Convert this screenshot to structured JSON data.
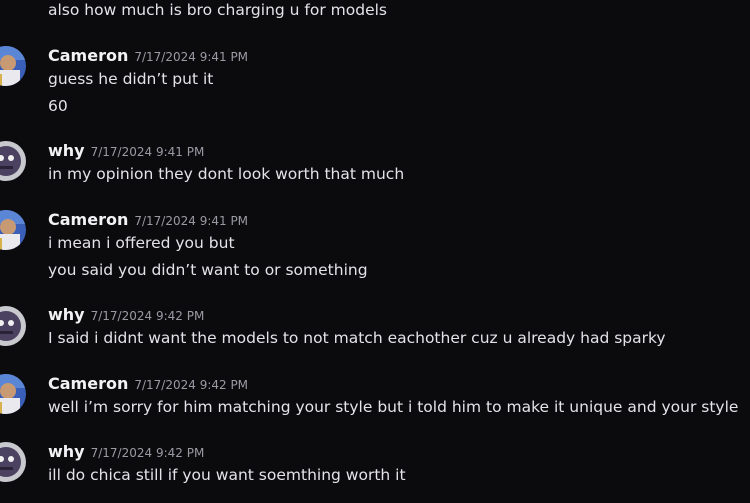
{
  "messages": {
    "prev_line": "also how much is bro charging u for models",
    "g1": {
      "author": "Cameron",
      "time": "7/17/2024 9:41 PM",
      "lines": [
        "guess he didn’t put it",
        "60"
      ],
      "avatar_icon": "cameron-avatar-icon"
    },
    "g2": {
      "author": "why",
      "time": "7/17/2024 9:41 PM",
      "lines": [
        "in my opinion they dont look worth that much"
      ],
      "avatar_icon": "why-avatar-icon"
    },
    "g3": {
      "author": "Cameron",
      "time": "7/17/2024 9:41 PM",
      "lines": [
        "i mean i offered you but",
        "you said you didn’t want to or something"
      ],
      "avatar_icon": "cameron-avatar-icon"
    },
    "g4": {
      "author": "why",
      "time": "7/17/2024 9:42 PM",
      "lines": [
        "I said i didnt want the models to not match eachother cuz u already had sparky"
      ],
      "avatar_icon": "why-avatar-icon"
    },
    "g5": {
      "author": "Cameron",
      "time": "7/17/2024 9:42 PM",
      "lines": [
        "well i’m sorry for him matching your style but i told him to make it unique and your style"
      ],
      "avatar_icon": "cameron-avatar-icon"
    },
    "g6": {
      "author": "why",
      "time": "7/17/2024 9:42 PM",
      "lines": [
        "ill do chica still if you want soemthing worth it"
      ],
      "avatar_icon": "why-avatar-icon"
    }
  },
  "colors": {
    "background": "#0b0b0e",
    "author": "#f2f2f5",
    "timestamp": "#9a9aa3",
    "text": "#e3e3e8"
  }
}
